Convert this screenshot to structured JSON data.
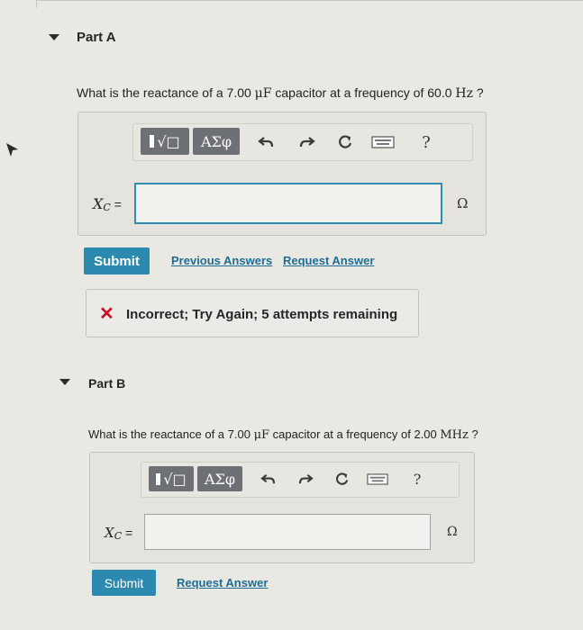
{
  "partA": {
    "label": "Part A",
    "question_prefix": "What is the reactance of a 7.00 ",
    "question_unit_mu": "μF",
    "question_mid": " capacitor at a frequency of 60.0 ",
    "question_unit_freq": "Hz",
    "question_suffix": " ?",
    "variable": "X",
    "variable_sub": "C",
    "equals": " =",
    "input_value": "",
    "unit": "Ω",
    "submit_label": "Submit",
    "previous_answers_label": "Previous Answers",
    "request_answer_label": "Request Answer",
    "feedback_icon": "✕",
    "feedback_text": "Incorrect; Try Again; 5 attempts remaining"
  },
  "partB": {
    "label": "Part B",
    "question_prefix": "What is the reactance of a 7.00 ",
    "question_unit_mu": "μF",
    "question_mid": " capacitor at a frequency of 2.00 ",
    "question_unit_freq": "MHz",
    "question_suffix": " ?",
    "variable": "X",
    "variable_sub": "C",
    "equals": " =",
    "input_value": "",
    "unit": "Ω",
    "submit_label": "Submit",
    "request_answer_label": "Request Answer"
  },
  "toolbar": {
    "templates_label": "√□",
    "greek_label": "ΑΣφ",
    "help_label": "?"
  },
  "icons": {
    "undo": "undo-icon",
    "redo": "redo-icon",
    "reset": "reset-icon",
    "keyboard": "keyboard-icon",
    "help": "help-icon"
  },
  "colors": {
    "submit": "#2c8ab0",
    "link": "#1f6d94",
    "error": "#c8102e",
    "focus": "#2f8db0"
  }
}
